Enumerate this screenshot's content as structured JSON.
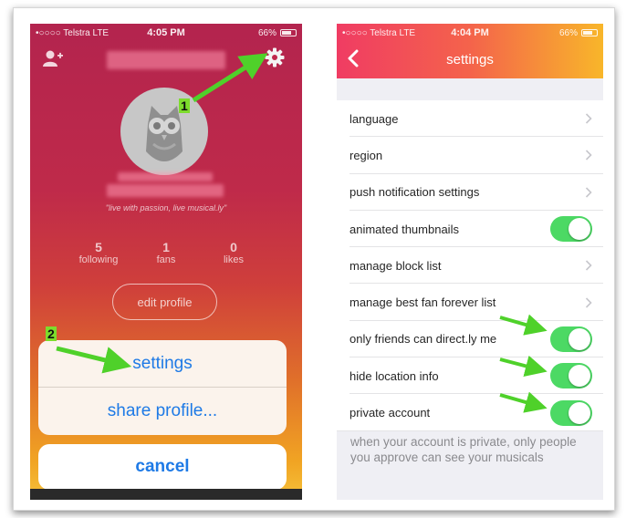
{
  "left_phone": {
    "status_bar": {
      "carrier": "•○○○○ Telstra",
      "network": "LTE",
      "time": "4:05 PM",
      "battery": "66%"
    },
    "icons": {
      "add_user": "add-user-icon",
      "settings": "gear-icon",
      "avatar": "owl-avatar"
    },
    "bio": "\"live with passion, live musical.ly\"",
    "stats": [
      {
        "value": "5",
        "label": "following"
      },
      {
        "value": "1",
        "label": "fans"
      },
      {
        "value": "0",
        "label": "likes"
      }
    ],
    "edit_profile_label": "edit profile",
    "action_sheet": {
      "settings_label": "settings",
      "share_label": "share profile...",
      "cancel_label": "cancel"
    }
  },
  "right_phone": {
    "status_bar": {
      "carrier": "•○○○○ Telstra",
      "network": "LTE",
      "time": "4:04 PM",
      "battery": "66%"
    },
    "title": "settings",
    "rows": [
      {
        "label": "language",
        "control": "chevron"
      },
      {
        "label": "region",
        "control": "chevron"
      },
      {
        "label": "push notification settings",
        "control": "chevron"
      },
      {
        "label": "animated thumbnails",
        "control": "toggle",
        "on": true
      },
      {
        "label": "manage block list",
        "control": "chevron"
      },
      {
        "label": "manage best fan forever list",
        "control": "chevron"
      },
      {
        "label": "only friends can direct.ly me",
        "control": "toggle",
        "on": true
      },
      {
        "label": "hide location info",
        "control": "toggle",
        "on": true
      },
      {
        "label": "private account",
        "control": "toggle",
        "on": true
      }
    ],
    "footnote": "when your account is private, only people you approve can see your musicals"
  },
  "annotations": {
    "step1": "1",
    "step2": "2",
    "arrow_color": "#4fd12a"
  },
  "colors": {
    "ios_blue": "#1e7ae6",
    "toggle_green": "#4cd964",
    "header_start": "#f03c63",
    "header_end": "#f8b62a"
  }
}
